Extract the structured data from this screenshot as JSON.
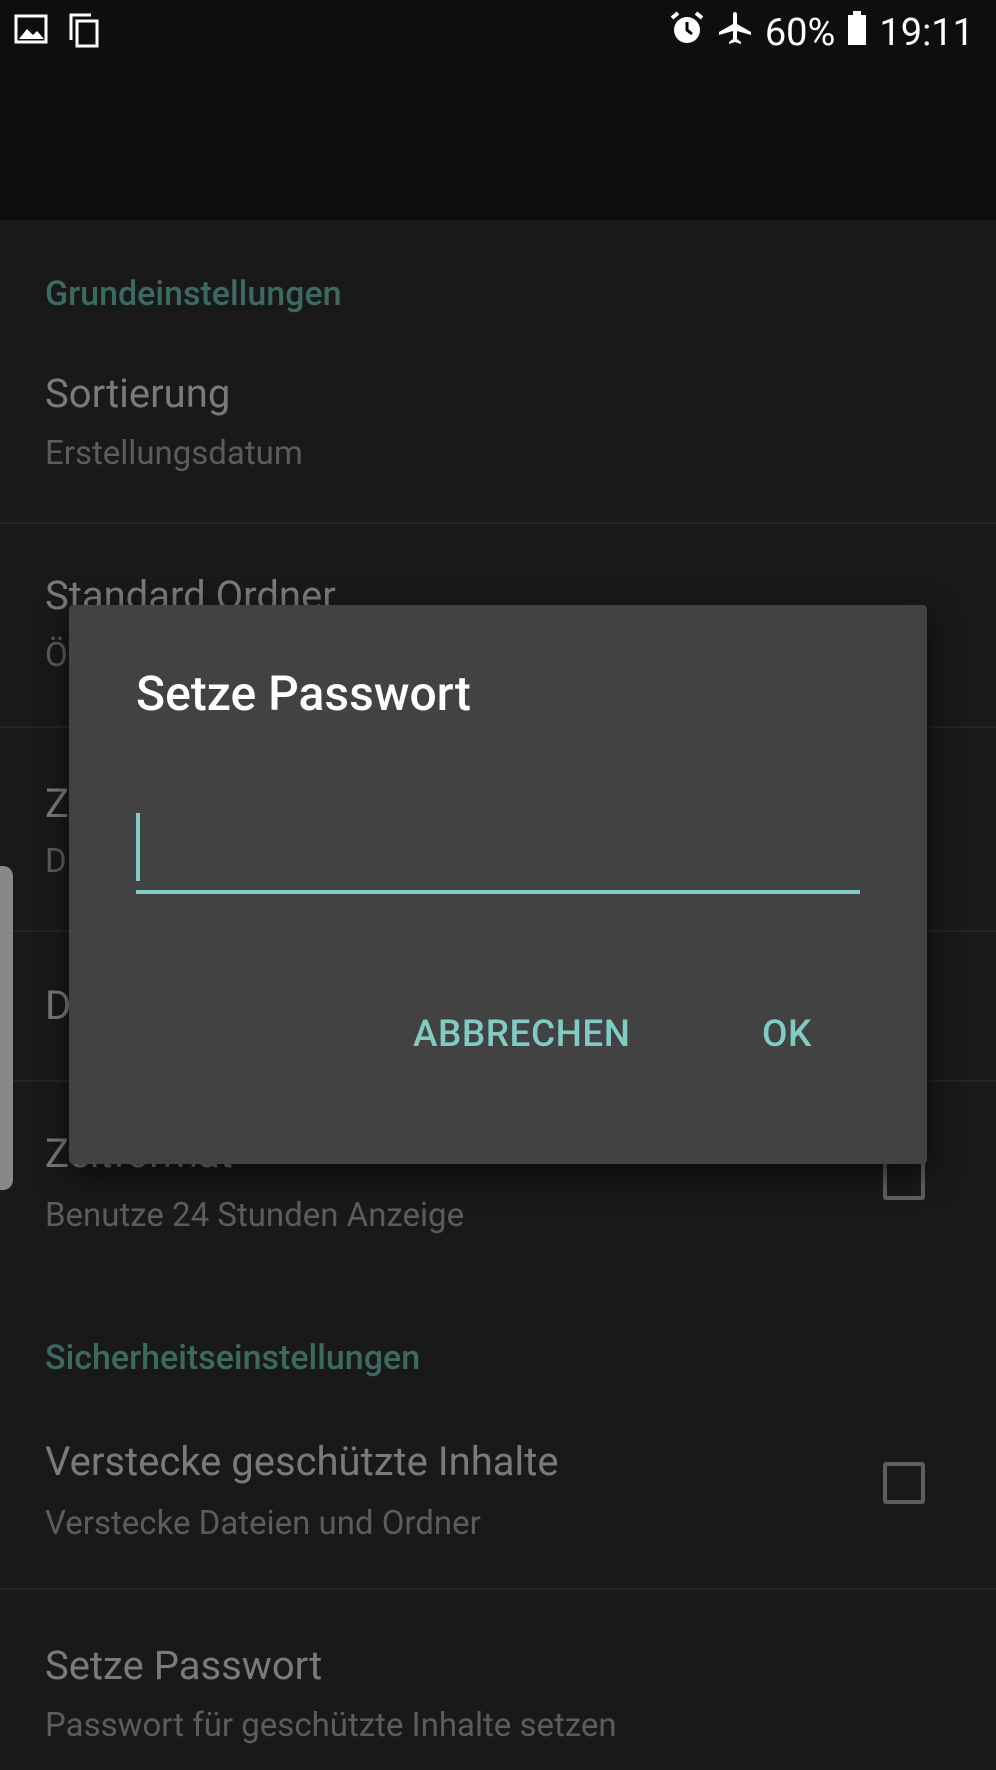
{
  "status_bar": {
    "icons_left": [
      "image-icon",
      "copy-icon"
    ],
    "icons_right": [
      "alarm-icon",
      "airplane-icon",
      "battery-icon"
    ],
    "battery_percent": "60%",
    "time": "19:11"
  },
  "settings": {
    "basic_header": "Grundeinstellungen",
    "sort_title": "Sortierung",
    "sort_summary": "Erstellungsdatum",
    "default_folder_title": "Standard Ordner",
    "default_folder_summary_partial": "Ö",
    "item3_title_partial": "Z",
    "item3_summary_partial": "D",
    "item4_title_partial": "D",
    "time_format_title": "Zeitformat",
    "time_format_summary": "Benutze 24 Stunden Anzeige",
    "time_format_checked": false,
    "security_header": "Sicherheitseinstellungen",
    "hide_protected_title": "Verstecke geschützte Inhalte",
    "hide_protected_summary": "Verstecke Dateien und Ordner",
    "hide_protected_checked": false,
    "set_password_title": "Setze Passwort",
    "set_password_summary": "Passwort für geschützte Inhalte setzen"
  },
  "dialog": {
    "title": "Setze Passwort",
    "input_value": "",
    "cancel_label": "ABBRECHEN",
    "ok_label": "OK"
  },
  "colors": {
    "accent": "#80cbc4",
    "section_header": "#3d6a60",
    "dialog_bg": "#424242"
  }
}
